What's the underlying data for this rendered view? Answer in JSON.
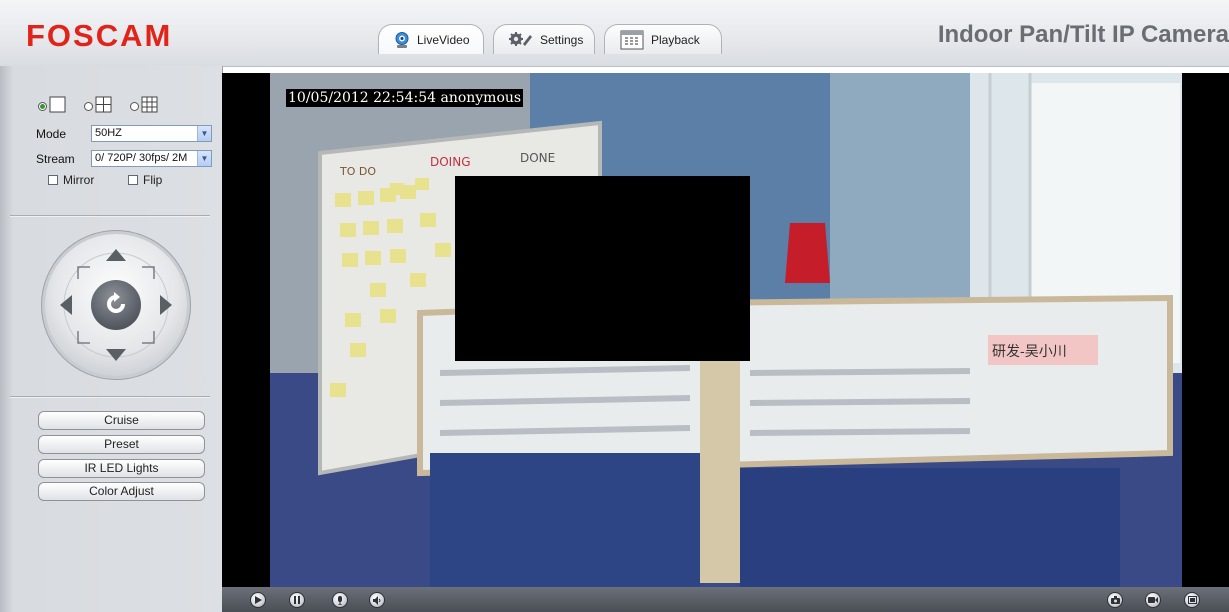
{
  "header": {
    "brand": "FOSCAM",
    "camera_title": "Indoor Pan/Tilt IP Camera",
    "tabs": [
      {
        "label": "LiveVideo",
        "icon": "webcam-icon",
        "active": true
      },
      {
        "label": "Settings",
        "icon": "gears-icon",
        "active": false
      },
      {
        "label": "Playback",
        "icon": "calendar-icon",
        "active": false
      }
    ]
  },
  "sidebar": {
    "layout_options": [
      {
        "name": "single-view",
        "selected": true
      },
      {
        "name": "quad-view",
        "selected": false
      },
      {
        "name": "nine-view",
        "selected": false
      }
    ],
    "mode_label": "Mode",
    "mode_value": "50HZ",
    "stream_label": "Stream",
    "stream_value": "0/ 720P/ 30fps/ 2M",
    "mirror_label": "Mirror",
    "flip_label": "Flip",
    "mirror_checked": false,
    "flip_checked": false,
    "buttons": [
      "Cruise",
      "Preset",
      "IR LED Lights",
      "Color Adjust"
    ]
  },
  "video": {
    "timestamp": "10/05/2012 22:54:54 anonymous",
    "board_labels": [
      "TO DO",
      "DOING",
      "DONE"
    ],
    "desk_sign": "研发-吴小川"
  },
  "bottom_bar": {
    "left_controls": [
      "play-icon",
      "stop-icon",
      "talk-icon",
      "audio-icon"
    ],
    "right_controls": [
      "snapshot-icon",
      "record-icon",
      "fullscreen-icon"
    ]
  },
  "colors": {
    "brand_red": "#e2231a",
    "title_gray": "#6a6d72",
    "video_border": "#000000"
  }
}
